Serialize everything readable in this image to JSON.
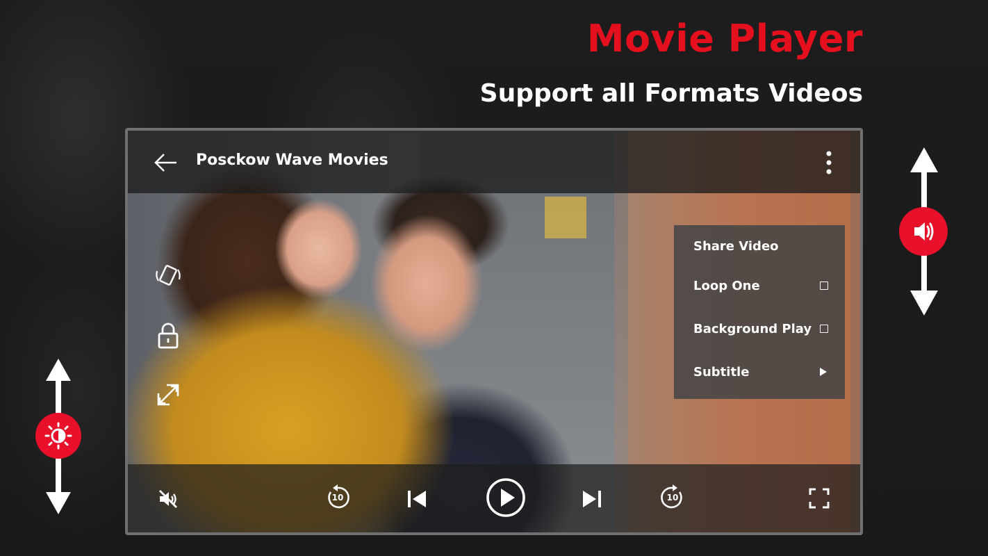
{
  "promo": {
    "headline": "Movie Player",
    "subheadline": "Support all Formats Videos"
  },
  "player": {
    "title": "Posckow Wave Movies",
    "menu": {
      "items": [
        {
          "label": "Share  Video",
          "control": "none"
        },
        {
          "label": "Loop One",
          "control": "checkbox",
          "checked": false
        },
        {
          "label": "Background Play",
          "control": "checkbox",
          "checked": false
        },
        {
          "label": "Subtitle",
          "control": "submenu-arrow"
        }
      ]
    },
    "side_controls": [
      "rotate-icon",
      "lock-icon",
      "resize-icon"
    ],
    "bottom_controls": {
      "rewind_seconds": "10",
      "forward_seconds": "10",
      "icons": [
        "mute-icon",
        "rewind-10-icon",
        "previous-icon",
        "play-icon",
        "next-icon",
        "forward-10-icon",
        "fullscreen-icon"
      ]
    }
  },
  "gesture_hints": {
    "brightness": "brightness-icon",
    "volume": "volume-icon"
  },
  "colors": {
    "accent": "#e4101e",
    "button_red": "#e8102a",
    "frame": "#707070",
    "background": "#1c1c1c"
  }
}
